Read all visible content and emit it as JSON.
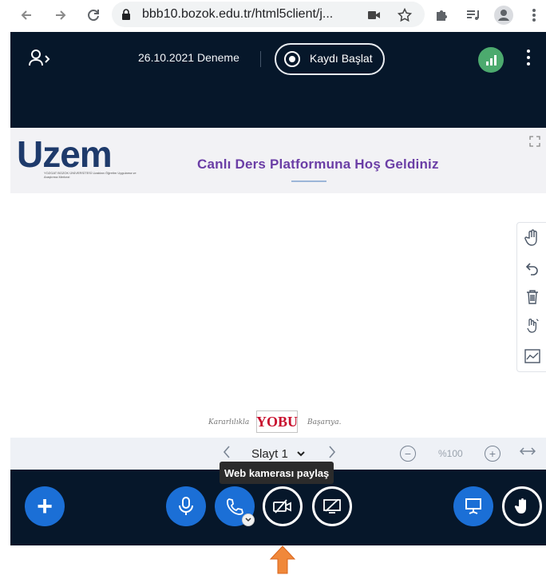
{
  "browser": {
    "url": "bbb10.bozok.edu.tr/html5client/j..."
  },
  "header": {
    "meeting_title": "26.10.2021 Deneme",
    "record_label": "Kaydı Başlat"
  },
  "slide": {
    "logo_text": "Uzem",
    "logo_subtitle": "YOZGAT BOZOK ÜNİVERSİTESİ Uzaktan Öğretim Uygulama ve Araştırma Merkezi",
    "welcome_text": "Canlı Ders Platformuna Hoş Geldiniz",
    "footer_left": "Kararlılıkla",
    "footer_brand": "YOBU",
    "footer_right": "Başarıya."
  },
  "presentation_controls": {
    "slide_label": "Slayt 1",
    "zoom_level": "%100"
  },
  "tooltip": {
    "text": "Web kamerası paylaş"
  },
  "colors": {
    "app_bg": "#06172a",
    "primary_blue": "#1b6fd6",
    "signal_green": "#4caa6e",
    "welcome_purple": "#6b3ea6",
    "arrow_orange": "#f0883a"
  },
  "icons": {
    "back": "arrow-left-icon",
    "forward": "arrow-right-icon",
    "reload": "reload-icon",
    "lock": "lock-icon",
    "camera": "video-camera-icon",
    "bookmark": "star-icon",
    "extensions": "puzzle-icon",
    "media": "playlist-icon",
    "profile": "person-icon",
    "hand": "hand-icon",
    "undo": "undo-icon",
    "trash": "trash-icon",
    "multi_user": "multi-user-pointer-icon",
    "chart": "chart-icon",
    "mic": "microphone-icon",
    "phone": "phone-icon",
    "webcam_off": "webcam-off-icon",
    "screen_share_off": "screen-share-off-icon",
    "presentation": "presentation-icon",
    "raise_hand": "raise-hand-icon"
  }
}
